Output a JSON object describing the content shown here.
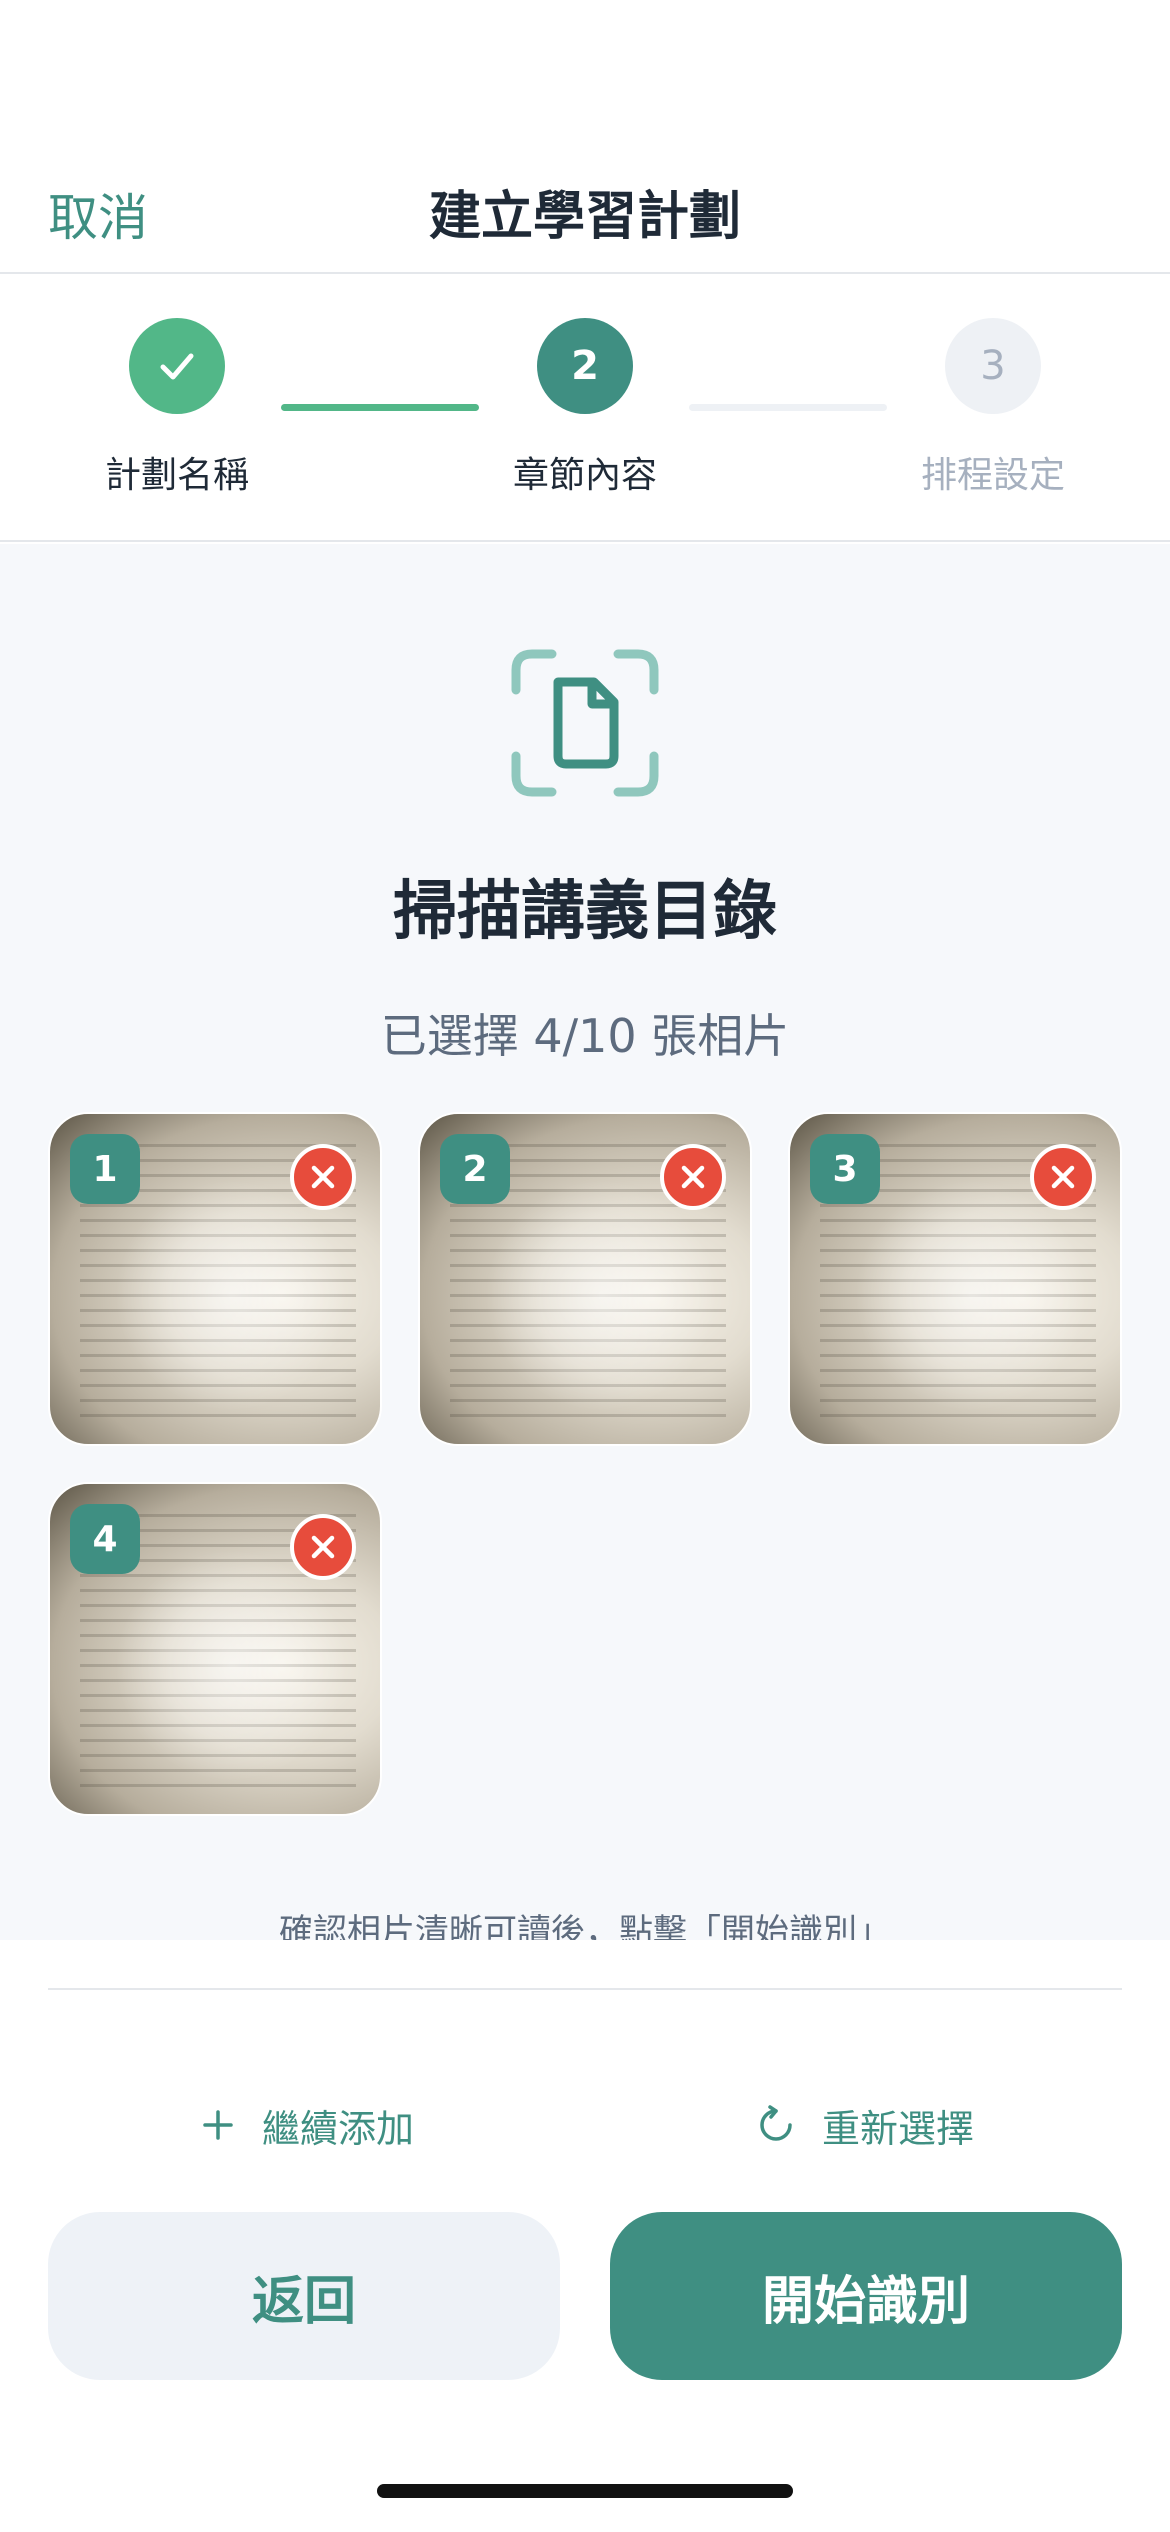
{
  "header": {
    "cancel_label": "取消",
    "title": "建立學習計劃"
  },
  "stepper": {
    "steps": [
      {
        "label": "計劃名稱",
        "number": "",
        "state": "done"
      },
      {
        "label": "章節內容",
        "number": "2",
        "state": "active"
      },
      {
        "label": "排程設定",
        "number": "3",
        "state": "pending"
      }
    ]
  },
  "content": {
    "icon": "document-scan-icon",
    "title": "掃描講義目錄",
    "subtitle": "已選擇 4/10 張相片",
    "photos": [
      {
        "index": "1"
      },
      {
        "index": "2"
      },
      {
        "index": "3"
      },
      {
        "index": "4"
      }
    ],
    "hint": "確認相片清晰可讀後，點擊「開始識別」"
  },
  "footer": {
    "add_more_label": "繼續添加",
    "reselect_label": "重新選擇",
    "back_label": "返回",
    "start_label": "開始識別"
  },
  "colors": {
    "primary": "#3f8f82",
    "success": "#52b788",
    "danger": "#e74c3c",
    "muted": "#a6b0bf"
  }
}
